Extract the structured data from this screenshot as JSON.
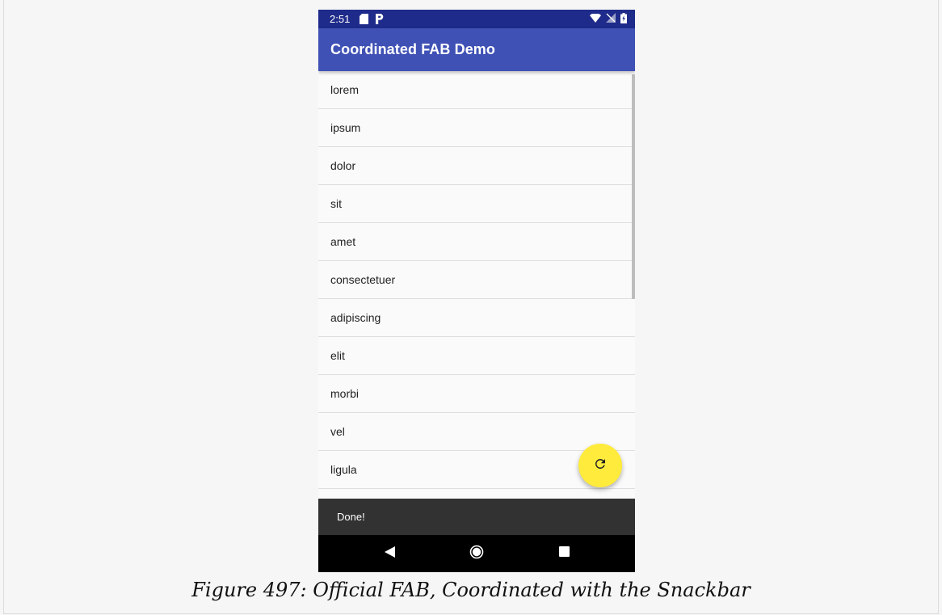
{
  "status_bar": {
    "time": "2:51",
    "icons": [
      "sd-card-icon",
      "parking-icon",
      "wifi-icon",
      "no-signal-icon",
      "battery-charging-icon"
    ]
  },
  "app_bar": {
    "title": "Coordinated FAB Demo",
    "color": "#3f51b5"
  },
  "list": {
    "items": [
      "lorem",
      "ipsum",
      "dolor",
      "sit",
      "amet",
      "consectetuer",
      "adipiscing",
      "elit",
      "morbi",
      "vel",
      "ligula"
    ]
  },
  "fab": {
    "icon": "refresh-icon",
    "color": "#ffeb3b"
  },
  "snackbar": {
    "message": "Done!"
  },
  "nav_bar": {
    "buttons": [
      "back-icon",
      "home-icon",
      "recents-icon"
    ]
  },
  "caption": {
    "text": "Figure 497: Official FAB, Coordinated with the Snackbar"
  }
}
